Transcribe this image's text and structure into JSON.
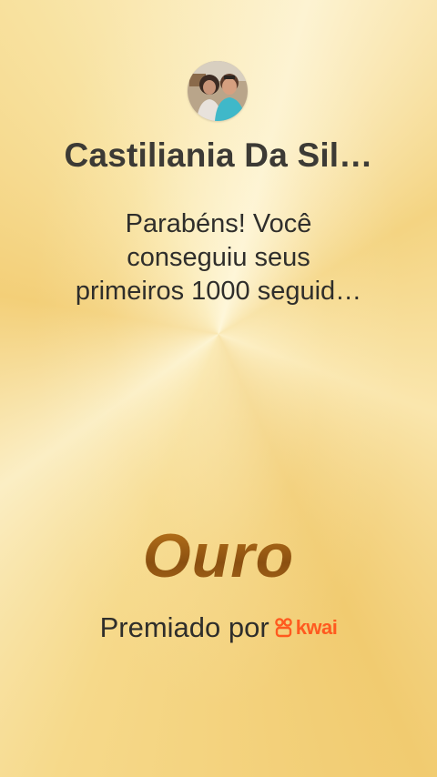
{
  "user": {
    "name": "Castiliania Da Sil…"
  },
  "message": {
    "lines": [
      "Parabéns! Você",
      "conseguiu seus",
      "primeiros 1000 seguid…"
    ]
  },
  "achievement": {
    "level": "Ouro"
  },
  "footer": {
    "awarded_by": "Premiado por",
    "brand_name": "kwai",
    "brand_color": "#ff5a1f"
  },
  "icons": {
    "avatar": "profile-photo",
    "brand_logo": "kwai-logo-icon"
  }
}
